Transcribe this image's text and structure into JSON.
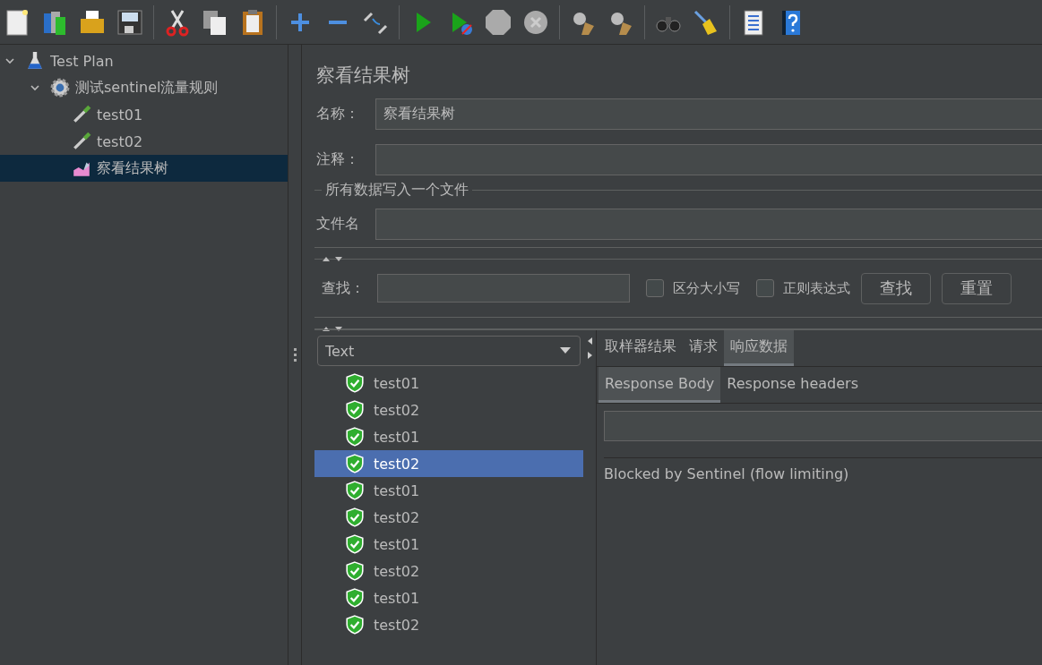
{
  "tree": [
    {
      "label": "Test Plan",
      "kind": "plan",
      "expanded": true,
      "selected": false,
      "children": [
        {
          "label": "测试sentinel流量规则",
          "kind": "group",
          "expanded": true,
          "selected": false,
          "children": [
            {
              "label": "test01",
              "kind": "sampler",
              "selected": false
            },
            {
              "label": "test02",
              "kind": "sampler",
              "selected": false
            },
            {
              "label": "察看结果树",
              "kind": "listener",
              "selected": true
            }
          ]
        }
      ]
    }
  ],
  "panel": {
    "title": "察看结果树",
    "name_label": "名称：",
    "name_value": "察看结果树",
    "comment_label": "注释：",
    "file_group": "所有数据写入一个文件",
    "file_label": "文件名"
  },
  "search": {
    "label": "查找：",
    "options": [
      {
        "label": "区分大小写",
        "checked": false
      },
      {
        "label": "正则表达式",
        "checked": false
      }
    ],
    "buttons": [
      "查找",
      "重置"
    ]
  },
  "renderer": "Text",
  "results": [
    {
      "label": "test01",
      "selected": false
    },
    {
      "label": "test02",
      "selected": false
    },
    {
      "label": "test01",
      "selected": false
    },
    {
      "label": "test02",
      "selected": true
    },
    {
      "label": "test01",
      "selected": false
    },
    {
      "label": "test02",
      "selected": false
    },
    {
      "label": "test01",
      "selected": false
    },
    {
      "label": "test02",
      "selected": false
    },
    {
      "label": "test01",
      "selected": false
    },
    {
      "label": "test02",
      "selected": false
    }
  ],
  "tabs": [
    {
      "label": "取样器结果",
      "selected": false
    },
    {
      "label": "请求",
      "selected": false
    },
    {
      "label": "响应数据",
      "selected": true
    }
  ],
  "subtabs": [
    {
      "label": "Response Body",
      "selected": true
    },
    {
      "label": "Response headers",
      "selected": false
    }
  ],
  "response_text": "Blocked by Sentinel (flow limiting)"
}
